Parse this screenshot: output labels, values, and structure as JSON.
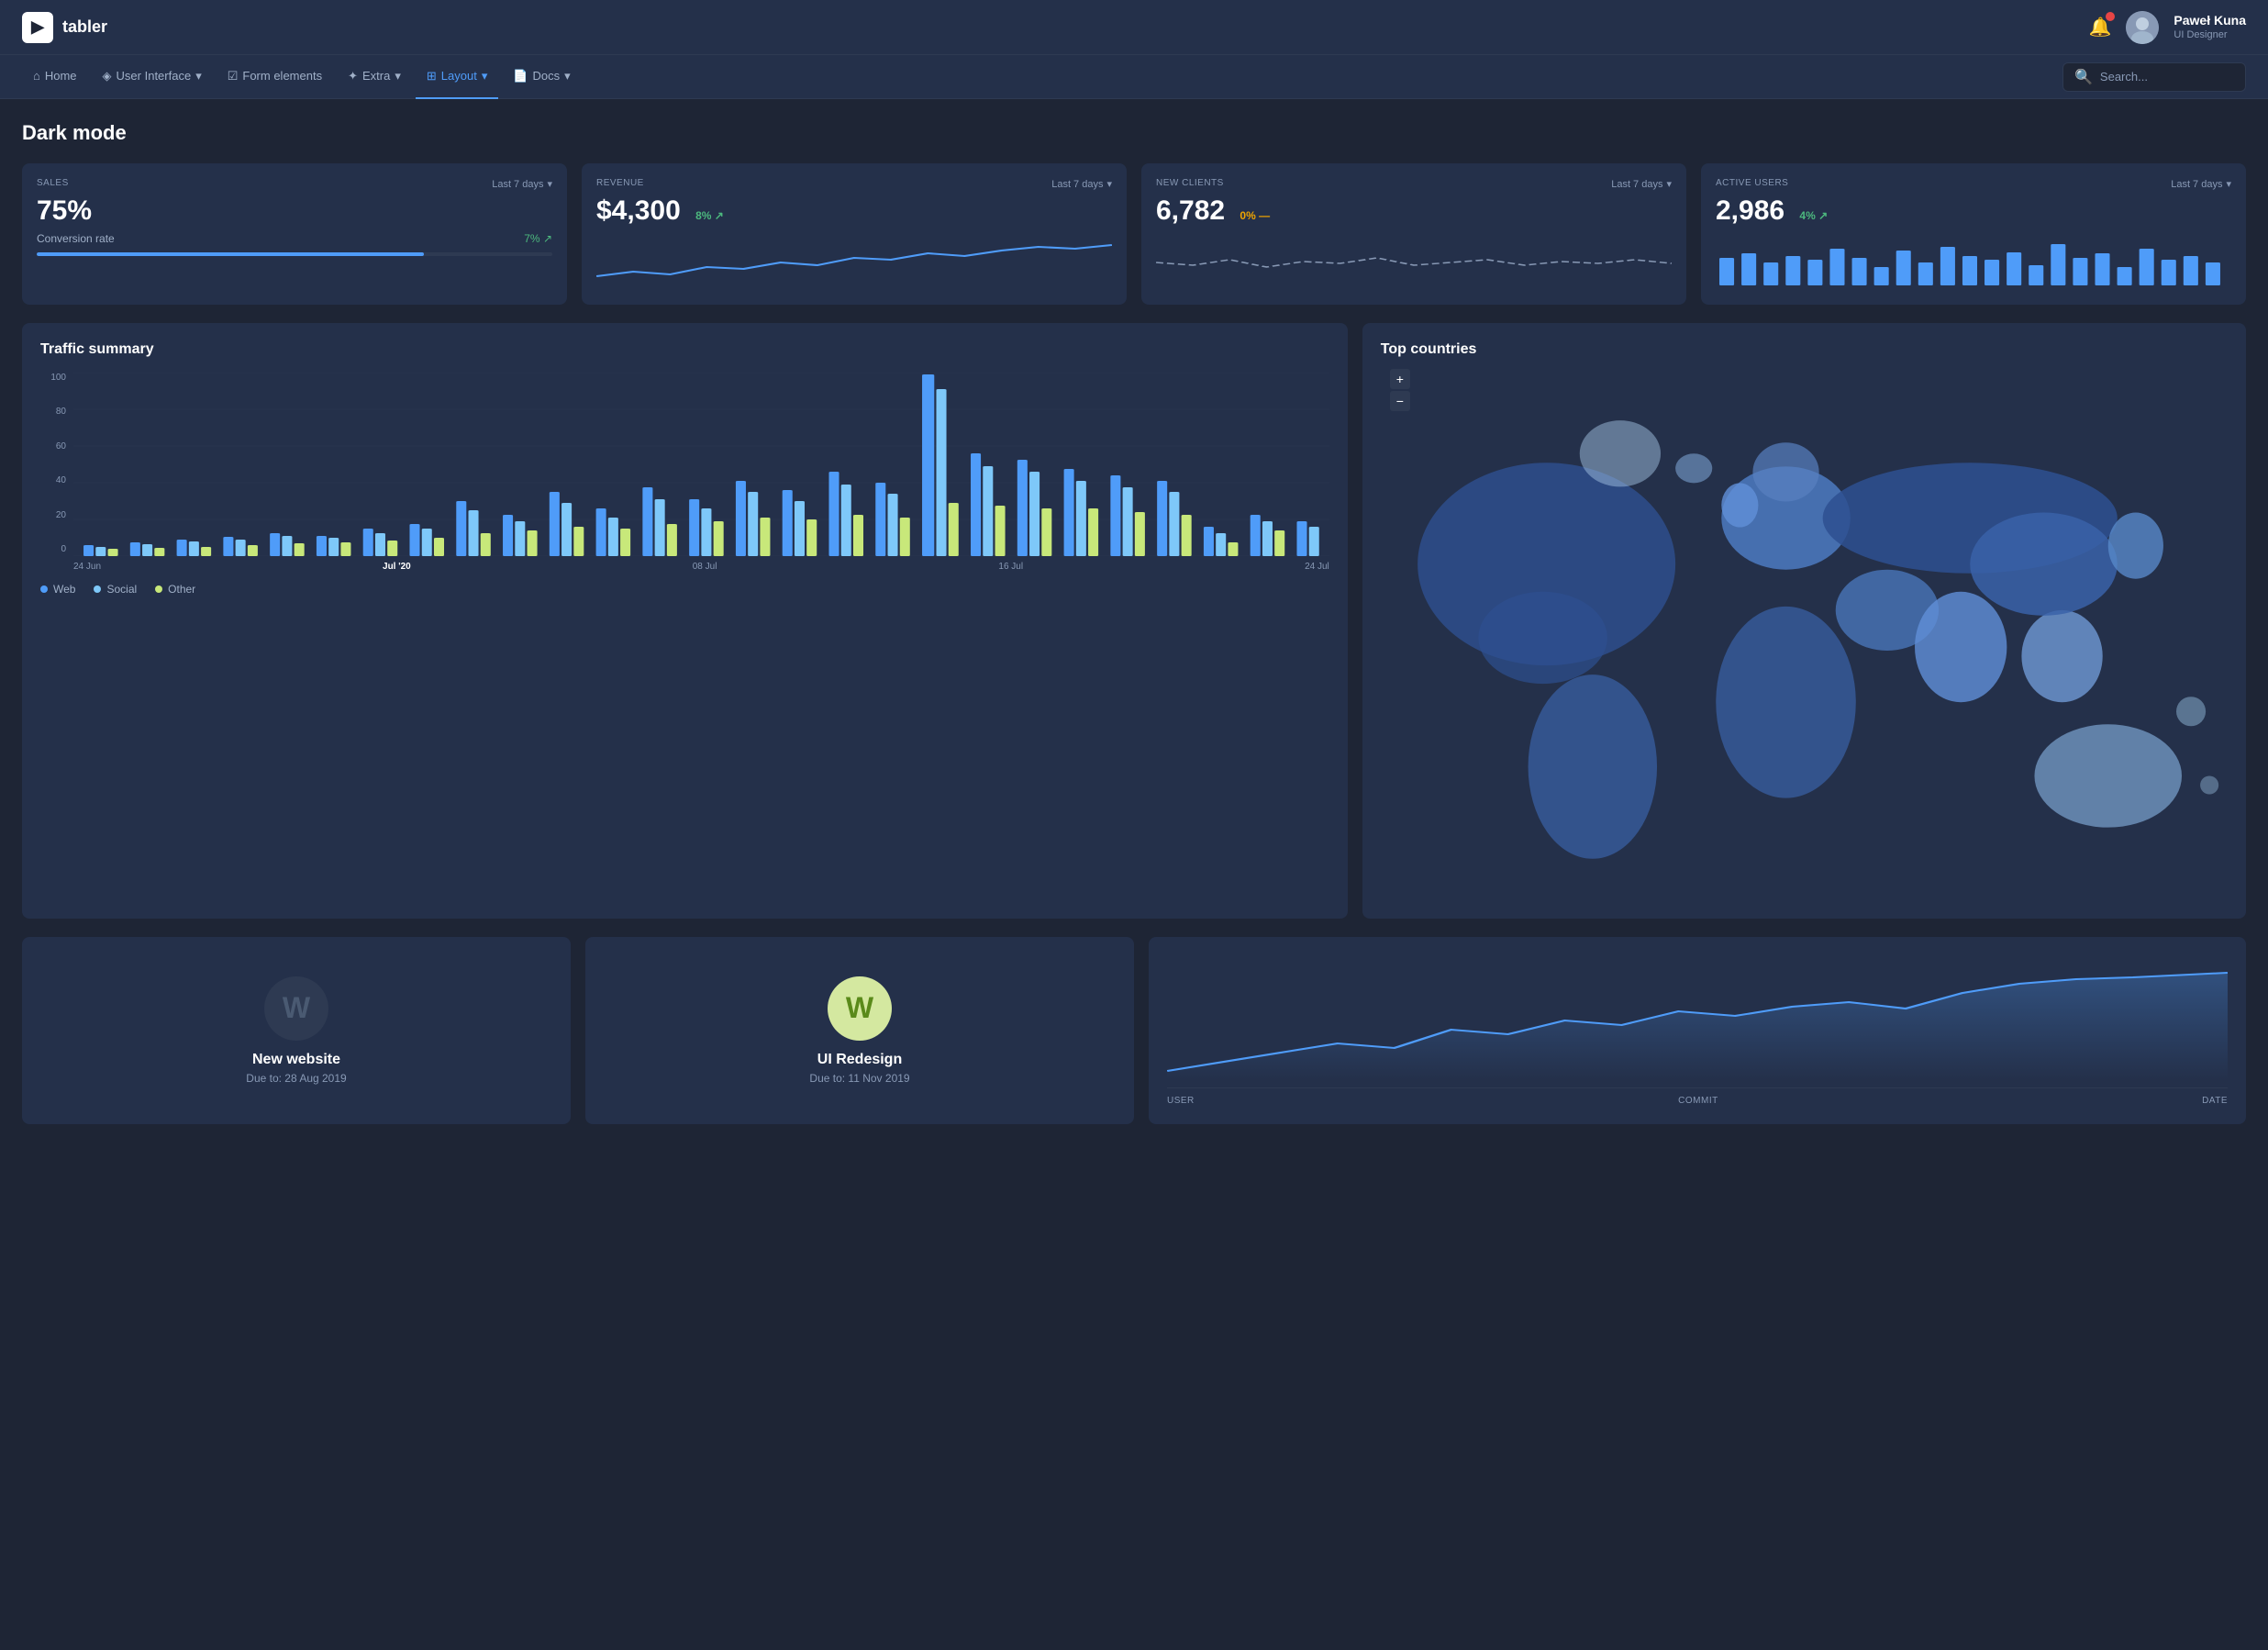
{
  "header": {
    "logo_text": "tabler",
    "logo_icon": "▶",
    "user_name": "Paweł Kuna",
    "user_role": "UI Designer",
    "notification_count": 1
  },
  "nav": {
    "items": [
      {
        "label": "Home",
        "icon": "⌂",
        "active": false
      },
      {
        "label": "User Interface",
        "icon": "◈",
        "active": false,
        "has_dropdown": true
      },
      {
        "label": "Form elements",
        "icon": "☑",
        "active": false
      },
      {
        "label": "Extra",
        "icon": "✦",
        "active": false,
        "has_dropdown": true
      },
      {
        "label": "Layout",
        "icon": "⊞",
        "active": true,
        "has_dropdown": true
      },
      {
        "label": "Docs",
        "icon": "📄",
        "active": false,
        "has_dropdown": true
      }
    ],
    "search_placeholder": "Search..."
  },
  "page": {
    "title": "Dark mode"
  },
  "stat_cards": [
    {
      "label": "SALES",
      "period": "Last 7 days",
      "value": "75%",
      "sub_label": "Conversion rate",
      "sub_change": "7%",
      "sub_change_type": "positive",
      "progress": 75
    },
    {
      "label": "REVENUE",
      "period": "Last 7 days",
      "value": "$4,300",
      "change": "8%",
      "change_type": "positive"
    },
    {
      "label": "NEW CLIENTS",
      "period": "Last 7 days",
      "value": "6,782",
      "change": "0%",
      "change_type": "neutral"
    },
    {
      "label": "ACTIVE USERS",
      "period": "Last 7 days",
      "value": "2,986",
      "change": "4%",
      "change_type": "positive"
    }
  ],
  "traffic_summary": {
    "title": "Traffic summary",
    "x_labels": [
      "24 Jun",
      "Jul '20",
      "08 Jul",
      "16 Jul",
      "24 Jul"
    ],
    "y_labels": [
      "0",
      "20",
      "40",
      "60",
      "80",
      "100"
    ],
    "legend": [
      {
        "label": "Web",
        "color": "#4f9cf9"
      },
      {
        "label": "Social",
        "color": "#7ec8f9"
      },
      {
        "label": "Other",
        "color": "#c8e87a"
      }
    ]
  },
  "top_countries": {
    "title": "Top countries"
  },
  "projects": [
    {
      "name": "New website",
      "due": "Due to: 28 Aug 2019",
      "initial": "W",
      "avatar_type": "gray"
    },
    {
      "name": "UI Redesign",
      "due": "Due to: 11 Nov 2019",
      "initial": "W",
      "avatar_type": "green"
    }
  ],
  "activity": {
    "columns": [
      "USER",
      "COMMIT",
      "DATE"
    ]
  },
  "colors": {
    "background": "#1e2535",
    "card_bg": "#24304a",
    "accent_blue": "#4f9cf9",
    "accent_green": "#4cb87e",
    "accent_yellow": "#f0a500",
    "bar_blue": "#4f9cf9",
    "bar_light_blue": "#7ec8f9",
    "bar_yellow_green": "#c8e87a"
  }
}
